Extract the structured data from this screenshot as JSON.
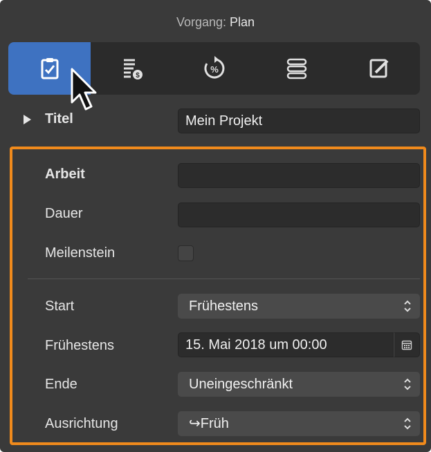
{
  "header": {
    "prefix": "Vorgang:",
    "value": "Plan"
  },
  "tabs": [
    {
      "icon": "clipboard-check-icon",
      "active": true
    },
    {
      "icon": "cost-list-icon",
      "active": false
    },
    {
      "icon": "percent-progress-icon",
      "active": false
    },
    {
      "icon": "list-rows-icon",
      "active": false
    },
    {
      "icon": "edit-note-icon",
      "active": false
    }
  ],
  "title_row": {
    "label": "Titel",
    "value": "Mein Projekt"
  },
  "fields": {
    "arbeit": {
      "label": "Arbeit",
      "value": ""
    },
    "dauer": {
      "label": "Dauer",
      "value": ""
    },
    "meilenstein": {
      "label": "Meilenstein",
      "checked": false
    }
  },
  "scheduling": {
    "start": {
      "label": "Start",
      "value": "Frühestens"
    },
    "fruehestens": {
      "label": "Frühestens",
      "value": "15. Mai 2018 um 00:00"
    },
    "ende": {
      "label": "Ende",
      "value": "Uneingeschränkt"
    },
    "ausrichtung": {
      "label": "Ausrichtung",
      "value": "↪Früh"
    }
  },
  "colors": {
    "accent": "#3e72c1",
    "highlight": "#f08a1c",
    "panel": "#3a3a3a"
  }
}
